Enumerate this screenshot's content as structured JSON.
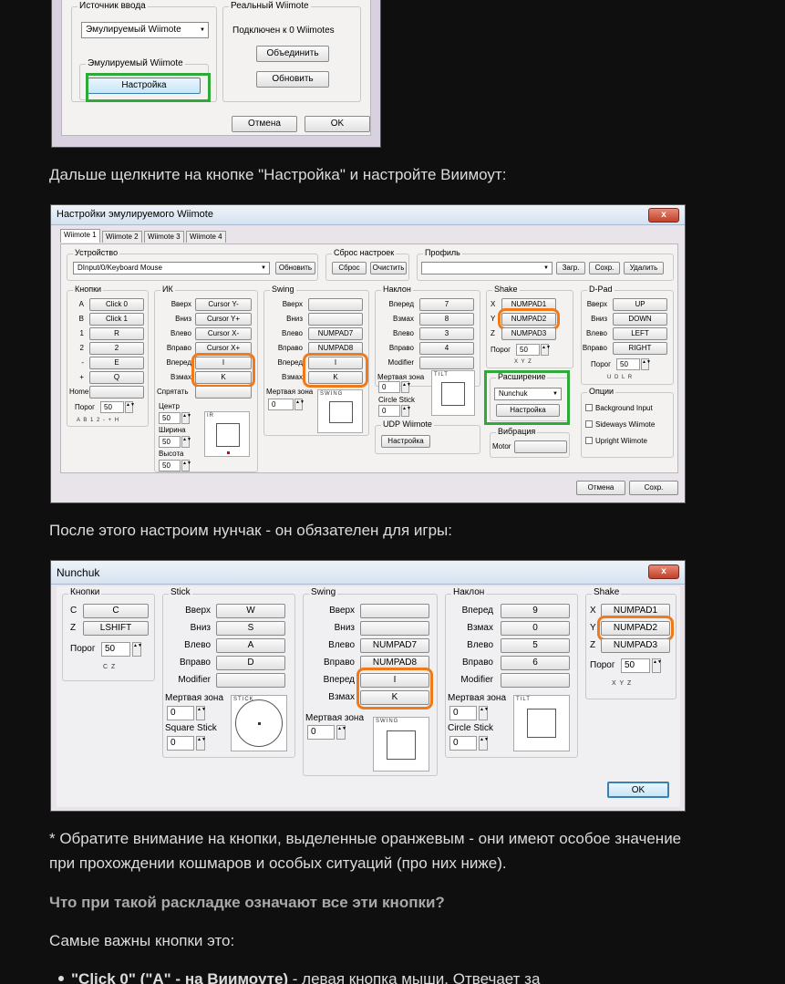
{
  "top_dialog": {
    "source_group": "Источник ввода",
    "source_value": "Эмулируемый Wiimote",
    "emulated_group": "Эмулируемый Wiimote",
    "config_btn": "Настройка",
    "real_group": "Реальный Wiimote",
    "connected": "Подключен к  0  Wiimotes",
    "pair_btn": "Объединить",
    "refresh_btn": "Обновить",
    "cancel_btn": "Отмена",
    "ok_btn": "OK"
  },
  "text1": "Дальше щелкните на кнопке \"Настройка\" и настройте Виимоут:",
  "wm": {
    "title": "Настройки эмулируемого Wiimote",
    "close": "x",
    "tabs": [
      "Wiimote 1",
      "Wiimote 2",
      "Wiimote 3",
      "Wiimote 4"
    ],
    "device_label": "Устройство",
    "device_value": "DInput/0/Keyboard Mouse",
    "refresh": "Обновить",
    "reset_label": "Сброс настроек",
    "reset": "Сброс",
    "clear": "Очистить",
    "profile_label": "Профиль",
    "load": "Загр.",
    "save": "Сохр.",
    "delete": "Удалить",
    "buttons": {
      "title": "Кнопки",
      "rows": [
        [
          "A",
          "Click 0"
        ],
        [
          "B",
          "Click 1"
        ],
        [
          "1",
          "R"
        ],
        [
          "2",
          "2"
        ],
        [
          "-",
          "E"
        ],
        [
          "+",
          "Q"
        ],
        [
          "Home",
          ""
        ]
      ],
      "threshold": "Порог",
      "threshold_val": "50",
      "letters": "A B 1 2 - + H"
    },
    "ir": {
      "title": "ИК",
      "rows": [
        [
          "Вверх",
          "Cursor Y-"
        ],
        [
          "Вниз",
          "Cursor Y+"
        ],
        [
          "Влево",
          "Cursor X-"
        ],
        [
          "Вправо",
          "Cursor X+"
        ],
        [
          "Вперед",
          "I"
        ],
        [
          "Взмах",
          "K"
        ],
        [
          "Спрятать",
          ""
        ]
      ],
      "center": "Центр",
      "center_val": "50",
      "width": "Ширина",
      "width_val": "50",
      "height": "Высота",
      "height_val": "50",
      "preview": "IR"
    },
    "swing": {
      "title": "Swing",
      "rows": [
        [
          "Вверх",
          ""
        ],
        [
          "Вниз",
          ""
        ],
        [
          "Влево",
          "NUMPAD7"
        ],
        [
          "Вправо",
          "NUMPAD8"
        ],
        [
          "Вперед",
          "I"
        ],
        [
          "Взмах",
          "K"
        ]
      ],
      "dead": "Мертвая зона",
      "dead_val": "0",
      "preview": "SWING"
    },
    "tilt": {
      "title": "Наклон",
      "rows": [
        [
          "Вперед",
          "7"
        ],
        [
          "Взмах",
          "8"
        ],
        [
          "Влево",
          "3"
        ],
        [
          "Вправо",
          "4"
        ],
        [
          "Modifier",
          ""
        ]
      ],
      "dead": "Мертвая зона",
      "dead_val": "0",
      "circle": "Circle Stick",
      "circle_val": "0",
      "preview": "TILT"
    },
    "udp": {
      "title": "UDP Wiimote",
      "btn": "Настройка"
    },
    "shake": {
      "title": "Shake",
      "rows": [
        [
          "X",
          "NUMPAD1"
        ],
        [
          "Y",
          "NUMPAD2"
        ],
        [
          "Z",
          "NUMPAD3"
        ]
      ],
      "threshold": "Порог",
      "threshold_val": "50",
      "letters": "X Y Z"
    },
    "ext": {
      "title": "Расширение",
      "value": "Nunchuk",
      "btn": "Настройка"
    },
    "vib": {
      "title": "Вибрация",
      "motor": "Motor"
    },
    "dpad": {
      "title": "D-Pad",
      "rows": [
        [
          "Вверх",
          "UP"
        ],
        [
          "Вниз",
          "DOWN"
        ],
        [
          "Влево",
          "LEFT"
        ],
        [
          "Вправо",
          "RIGHT"
        ]
      ],
      "threshold": "Порог",
      "threshold_val": "50",
      "letters": "U D L R"
    },
    "options": {
      "title": "Опции",
      "items": [
        "Background Input",
        "Sideways Wiimote",
        "Upright Wiimote"
      ]
    },
    "cancel": "Отмена",
    "ok": "Сохр."
  },
  "text2": "После этого настроим нунчак - он обязателен для игры:",
  "nc": {
    "title": "Nunchuk",
    "close": "x",
    "buttons": {
      "title": "Кнопки",
      "rows": [
        [
          "C",
          "C"
        ],
        [
          "Z",
          "LSHIFT"
        ]
      ],
      "threshold": "Порог",
      "threshold_val": "50",
      "letters": "C Z"
    },
    "stick": {
      "title": "Stick",
      "rows": [
        [
          "Вверх",
          "W"
        ],
        [
          "Вниз",
          "S"
        ],
        [
          "Влево",
          "A"
        ],
        [
          "Вправо",
          "D"
        ],
        [
          "Modifier",
          ""
        ]
      ],
      "dead": "Мертвая зона",
      "dead_val": "0",
      "square": "Square Stick",
      "square_val": "0",
      "preview": "STICK"
    },
    "swing": {
      "title": "Swing",
      "rows": [
        [
          "Вверх",
          ""
        ],
        [
          "Вниз",
          ""
        ],
        [
          "Влево",
          "NUMPAD7"
        ],
        [
          "Вправо",
          "NUMPAD8"
        ],
        [
          "Вперед",
          "I"
        ],
        [
          "Взмах",
          "K"
        ]
      ],
      "dead": "Мертвая зона",
      "dead_val": "0",
      "preview": "SWING"
    },
    "tilt": {
      "title": "Наклон",
      "rows": [
        [
          "Вперед",
          "9"
        ],
        [
          "Взмах",
          "0"
        ],
        [
          "Влево",
          "5"
        ],
        [
          "Вправо",
          "6"
        ],
        [
          "Modifier",
          ""
        ]
      ],
      "dead": "Мертвая зона",
      "dead_val": "0",
      "circle": "Circle Stick",
      "circle_val": "0",
      "preview": "TILT"
    },
    "shake": {
      "title": "Shake",
      "rows": [
        [
          "X",
          "NUMPAD1"
        ],
        [
          "Y",
          "NUMPAD2"
        ],
        [
          "Z",
          "NUMPAD3"
        ]
      ],
      "threshold": "Порог",
      "threshold_val": "50",
      "letters": "X Y Z"
    },
    "ok": "OK"
  },
  "note": "* Обратите внимание на кнопки, выделенные оранжевым - они имеют особое значение при прохождении кошмаров и особых ситуаций (про них ниже).",
  "question": "Что при такой раскладке означают все эти кнопки?",
  "text3": "Самые важны кнопки это:",
  "bullet_bold": "\"Click 0\" (\"A\" - на Виимоуте)",
  "bullet_rest": " - левая кнопка мыши. Отвечает за"
}
